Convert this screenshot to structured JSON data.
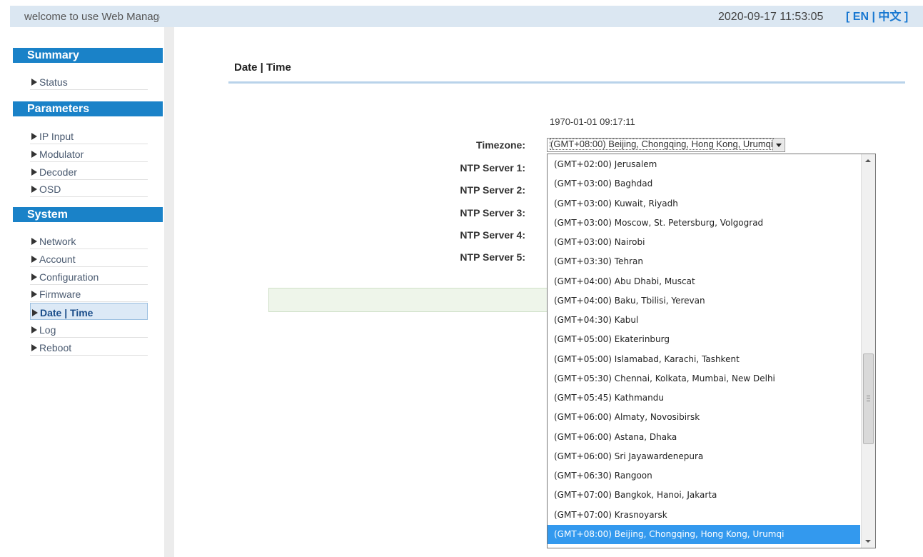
{
  "header": {
    "welcome": "welcome to use Web Management System",
    "datetime": "2020-09-17 11:53:05",
    "lang_open": "[",
    "lang_en": "EN",
    "lang_sep": "|",
    "lang_cn": "中文",
    "lang_close": "]"
  },
  "sidebar": {
    "sections": [
      {
        "title": "Summary",
        "items": [
          "Status"
        ]
      },
      {
        "title": "Parameters",
        "items": [
          "IP Input",
          "Modulator",
          "Decoder",
          "OSD"
        ]
      },
      {
        "title": "System",
        "items": [
          "Network",
          "Account",
          "Configuration",
          "Firmware",
          "Date | Time",
          "Log",
          "Reboot"
        ]
      }
    ],
    "active_item": "Date | Time"
  },
  "main": {
    "title": "Date | Time",
    "current_time": "1970-01-01 09:17:11",
    "timezone_label": "Timezone:",
    "timezone_value": "(GMT+08:00) Beijing, Chongqing, Hong Kong, Urumqi",
    "ntp_labels": [
      "NTP Server 1:",
      "NTP Server 2:",
      "NTP Server 3:",
      "NTP Server 4:",
      "NTP Server 5:"
    ]
  },
  "timezone_dropdown": {
    "options": [
      "(GMT+02:00) Jerusalem",
      "(GMT+03:00) Baghdad",
      "(GMT+03:00) Kuwait, Riyadh",
      "(GMT+03:00) Moscow, St. Petersburg, Volgograd",
      "(GMT+03:00) Nairobi",
      "(GMT+03:30) Tehran",
      "(GMT+04:00) Abu Dhabi, Muscat",
      "(GMT+04:00) Baku, Tbilisi, Yerevan",
      "(GMT+04:30) Kabul",
      "(GMT+05:00) Ekaterinburg",
      "(GMT+05:00) Islamabad, Karachi, Tashkent",
      "(GMT+05:30) Chennai, Kolkata, Mumbai, New Delhi",
      "(GMT+05:45) Kathmandu",
      "(GMT+06:00) Almaty, Novosibirsk",
      "(GMT+06:00) Astana, Dhaka",
      "(GMT+06:00) Sri Jayawardenepura",
      "(GMT+06:30) Rangoon",
      "(GMT+07:00) Bangkok, Hanoi, Jakarta",
      "(GMT+07:00) Krasnoyarsk",
      "(GMT+08:00) Beijing, Chongqing, Hong Kong, Urumqi"
    ],
    "selected_index": 19
  },
  "colors": {
    "accent": "#1a82c8",
    "selection": "#3399ee",
    "header_bg": "#dbe7f2",
    "lang_link": "#1777d1"
  }
}
